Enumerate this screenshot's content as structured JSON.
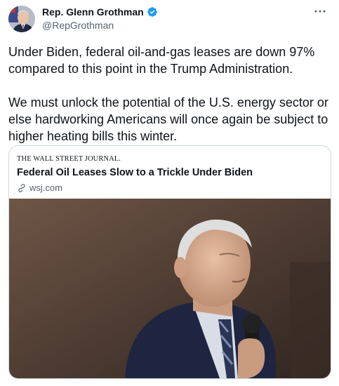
{
  "author": {
    "name": "Rep. Glenn Grothman",
    "handle": "@RepGrothman",
    "verified": true
  },
  "tweet": {
    "text": "Under Biden, federal oil-and-gas leases are down 97% compared to this point in the Trump Administration.\n\nWe must unlock the potential of the U.S. energy sector or else hardworking Americans will once again be subject to higher heating bills this winter."
  },
  "card": {
    "source": "THE WALL STREET JOURNAL.",
    "headline": "Federal Oil Leases Slow to a Trickle Under Biden",
    "domain": "wsj.com"
  },
  "colors": {
    "verified_badge": "#1d9bf0",
    "secondary_text": "#536471",
    "border": "#cfd9de"
  },
  "icons": [
    "verified-icon",
    "more-icon",
    "link-icon"
  ]
}
